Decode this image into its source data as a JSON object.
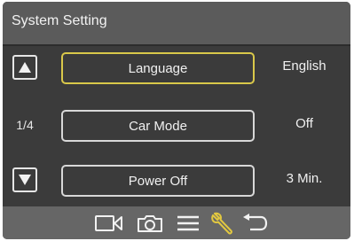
{
  "title": "System Setting",
  "page_indicator": "1/4",
  "menu": [
    {
      "label": "Language",
      "value": "English",
      "selected": true
    },
    {
      "label": "Car Mode",
      "value": "Off",
      "selected": false
    },
    {
      "label": "Power Off",
      "value": "3 Min.",
      "selected": false
    }
  ],
  "nav_icons": [
    "video-camera-icon",
    "photo-camera-icon",
    "menu-icon",
    "wrench-icon",
    "back-icon"
  ],
  "colors": {
    "background": "#3b3b3b",
    "title_bar": "#5b5b5b",
    "bottom_bar": "#666666",
    "selection_border": "#d9c84a",
    "active_icon": "#e2c840"
  }
}
